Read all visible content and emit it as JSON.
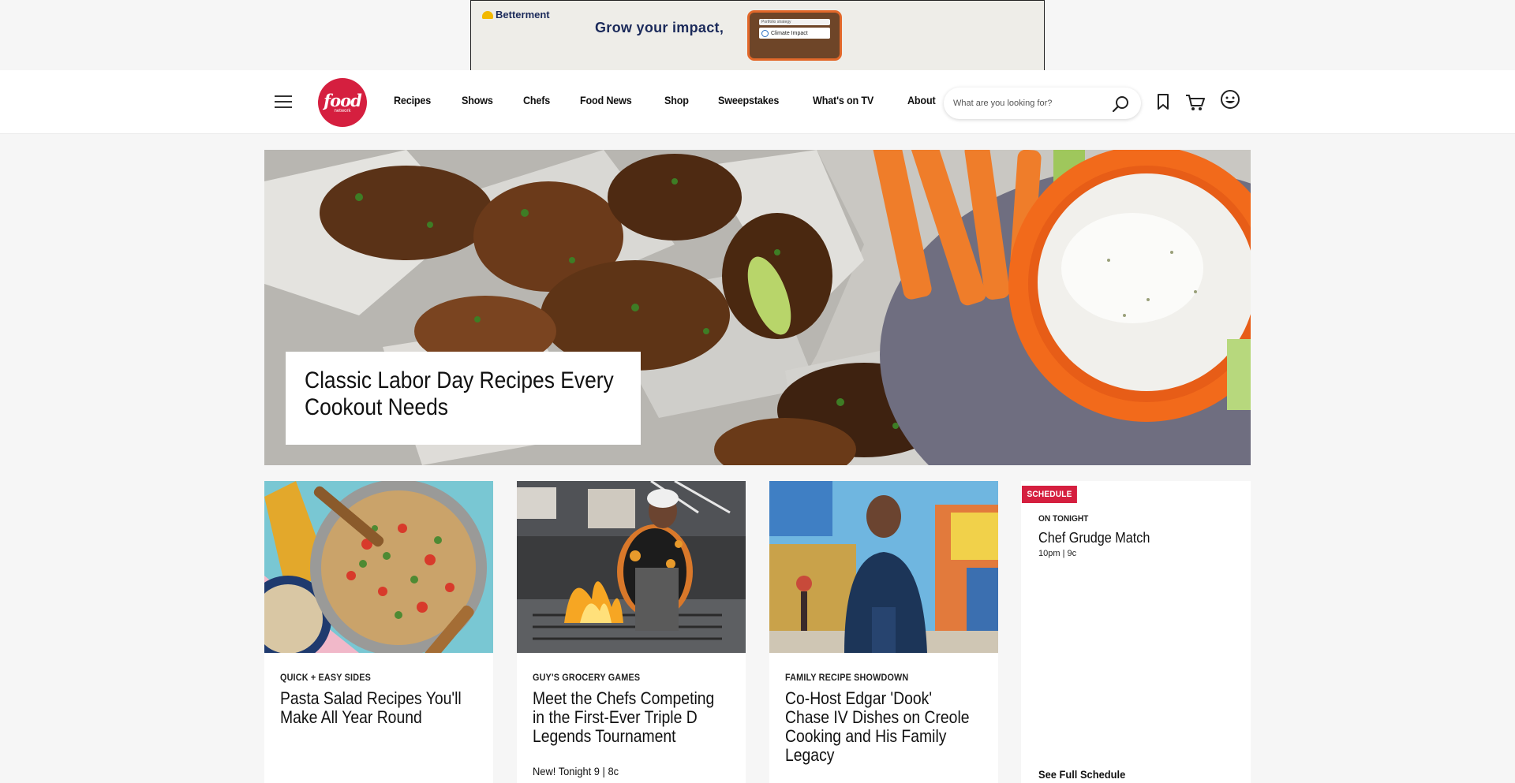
{
  "ad": {
    "brand": "Betterment",
    "headline": "Grow your impact,",
    "phone_line1": "Portfolio strategy",
    "phone_line2": "Climate Impact"
  },
  "header": {
    "logo_big": "food",
    "logo_small": "network",
    "nav": [
      "Recipes",
      "Shows",
      "Chefs",
      "Food News",
      "Shop",
      "Sweepstakes",
      "What's on TV",
      "About"
    ],
    "search_placeholder": "What are you looking for?"
  },
  "hero": {
    "title": "Classic Labor Day Recipes Every Cookout Needs"
  },
  "cards": [
    {
      "kicker": "QUICK + EASY SIDES",
      "title": "Pasta Salad Recipes You'll Make All Year Round",
      "meta": ""
    },
    {
      "kicker": "GUY'S GROCERY GAMES",
      "title": "Meet the Chefs Competing in the First-Ever Triple D Legends Tournament",
      "meta": "New! Tonight 9 | 8c"
    },
    {
      "kicker": "FAMILY RECIPE SHOWDOWN",
      "title": "Co-Host Edgar 'Dook' Chase IV Dishes on Creole Cooking and His Family Legacy",
      "meta": ""
    }
  ],
  "schedule": {
    "badge": "SCHEDULE",
    "on_tonight": "ON TONIGHT",
    "show": "Chef Grudge Match",
    "time": "10pm  |  9c",
    "link": "See Full Schedule"
  },
  "colors": {
    "brand_red": "#d51f3f",
    "page_bg": "#f6f6f6"
  }
}
